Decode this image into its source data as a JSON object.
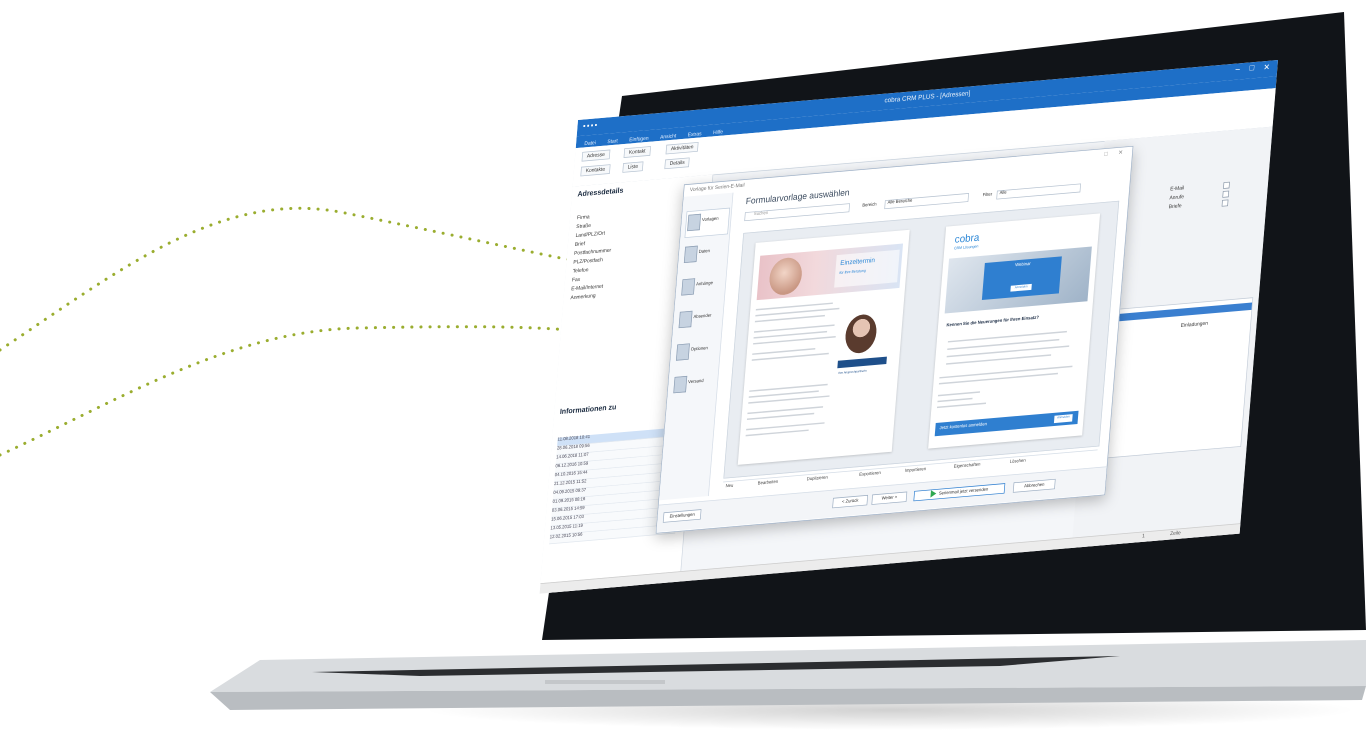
{
  "app": {
    "window_title": "cobra CRM PLUS - [Adressen]",
    "menu": [
      "Datei",
      "Start",
      "Einfügen",
      "Ansicht",
      "Extras",
      "Hilfe"
    ]
  },
  "ribbon": {
    "buttons": [
      "Adresse",
      "Kontakt",
      "Aktivitäten",
      "Kontakte",
      "Liste",
      "Details"
    ]
  },
  "left_pane": {
    "section_title": "Adressdetails",
    "fields": [
      "Firma",
      "Straße",
      "Land/PLZ/Ort",
      "Brief",
      "Postfachnummer",
      "PLZ/Postfach",
      "Telefon",
      "Fax",
      "E-Mail/Internet",
      "Anmerkung"
    ],
    "info_title": "Informationen zu",
    "history_rows": [
      "11.08.2018 10:41",
      "28.06.2018 09:56",
      "14.06.2018 11:07",
      "06.12.2016 10:59",
      "04.10.2016 15:44",
      "21.12.2015 11:52",
      "04.09.2015 09:37",
      "01.09.2015 08:16",
      "03.06.2015 14:59",
      "15.06.2015 17:03",
      "13.05.2015 11:19",
      "12.02.2015 10:56"
    ]
  },
  "right_pane": {
    "options": [
      "E-Mail",
      "Anrufe",
      "Briefe"
    ],
    "list_items": [
      "Einladungen"
    ]
  },
  "dialog": {
    "title": "Vorlage für Serien-E-Mail",
    "heading": "Formularvorlage auswählen",
    "search_placeholder": "Suchen",
    "filter1_label": "Bereich",
    "filter1_value": "Alle Bereiche",
    "filter2_label": "Filter",
    "filter2_value": "Alle",
    "nav_items": [
      "Vorlagen",
      "Daten",
      "Anhänge",
      "Absender",
      "Optionen",
      "Versand"
    ],
    "template_1": {
      "banner_title": "Einzeltermin",
      "banner_subtitle": "für Ihre Beratung",
      "side_label": "Ihre Ansprechpartnerin"
    },
    "template_2": {
      "logo": "cobra",
      "logo_sub": "CRM Lösungen",
      "box_title": "Webinar",
      "box_button": "Anmelden",
      "headline": "Kennen Sie die Neuerungen für Ihren Einsatz?",
      "footer_text": "Jetzt kostenlos anmelden",
      "footer_button": "Anmelden"
    },
    "toolbar": [
      "Neu",
      "Bearbeiten",
      "Duplizieren",
      "Exportieren",
      "Importieren",
      "Eigenschaften",
      "Löschen"
    ],
    "footer_buttons": {
      "left": "Einstellungen",
      "back": "< Zurück",
      "next": "Weiter >",
      "primary": "Serienmail jetzt versenden",
      "cancel": "Abbrechen"
    }
  },
  "statusbar": {
    "page": "1",
    "mode": "Zeile"
  }
}
